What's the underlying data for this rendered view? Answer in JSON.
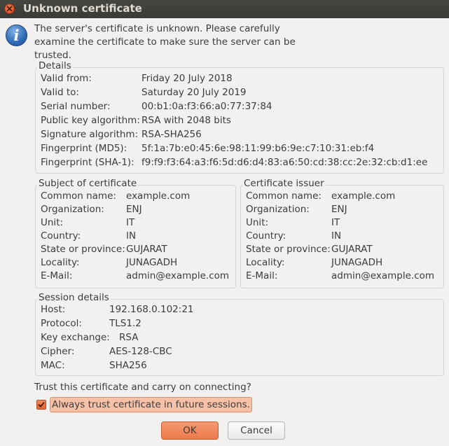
{
  "window": {
    "title": "Unknown certificate"
  },
  "message": {
    "lines": [
      "The server's certificate is unknown. Please carefully",
      "examine the certificate to make sure the server can be",
      "trusted."
    ]
  },
  "details": {
    "title": "Details",
    "rows": [
      {
        "label": "Valid from:",
        "value": "Friday 20 July 2018"
      },
      {
        "label": "Valid to:",
        "value": "Saturday 20 July 2019"
      },
      {
        "label": "Serial number:",
        "value": "00:b1:0a:f3:66:a0:77:37:84"
      },
      {
        "label": "Public key algorithm:",
        "value": "RSA with 2048 bits"
      },
      {
        "label": "Signature algorithm:",
        "value": "RSA-SHA256"
      },
      {
        "label": "Fingerprint (MD5):",
        "value": "5f:1a:7b:e0:45:6e:98:11:99:b6:9e:c7:10:31:eb:f4"
      },
      {
        "label": "Fingerprint (SHA-1):",
        "value": "f9:f9:f3:64:a3:f6:5d:d6:d4:83:a6:50:cd:38:cc:2e:32:cb:d1:ee"
      }
    ]
  },
  "subject": {
    "title": "Subject of certificate",
    "rows": [
      {
        "label": "Common name:",
        "value": "example.com"
      },
      {
        "label": "Organization:",
        "value": "ENJ"
      },
      {
        "label": "Unit:",
        "value": "IT"
      },
      {
        "label": "Country:",
        "value": "IN"
      },
      {
        "label": "State or province:",
        "value": "GUJARAT"
      },
      {
        "label": "Locality:",
        "value": "JUNAGADH"
      },
      {
        "label": "E-Mail:",
        "value": "admin@example.com"
      }
    ]
  },
  "issuer": {
    "title": "Certificate issuer",
    "rows": [
      {
        "label": "Common name:",
        "value": "example.com"
      },
      {
        "label": "Organization:",
        "value": "ENJ"
      },
      {
        "label": "Unit:",
        "value": "IT"
      },
      {
        "label": "Country:",
        "value": "IN"
      },
      {
        "label": "State or province:",
        "value": "GUJARAT"
      },
      {
        "label": "Locality:",
        "value": "JUNAGADH"
      },
      {
        "label": "E-Mail:",
        "value": "admin@example.com"
      }
    ]
  },
  "session": {
    "title": "Session details",
    "rows": [
      {
        "label": "Host:",
        "value": "192.168.0.102:21"
      },
      {
        "label": "Protocol:",
        "value": "TLS1.2"
      },
      {
        "label": "Key exchange:",
        "value": "RSA"
      },
      {
        "label": "Cipher:",
        "value": "AES-128-CBC"
      },
      {
        "label": "MAC:",
        "value": "SHA256"
      }
    ]
  },
  "trust": {
    "question": "Trust this certificate and carry on connecting?",
    "always_label": "Always trust certificate in future sessions.",
    "always_checked": true
  },
  "buttons": {
    "ok": "OK",
    "cancel": "Cancel"
  },
  "icons": {
    "close": "close-icon",
    "info": "info-icon",
    "check": "check-icon"
  },
  "colors": {
    "accent": "#ee7c4c",
    "titlebar": "#3c3b37"
  }
}
